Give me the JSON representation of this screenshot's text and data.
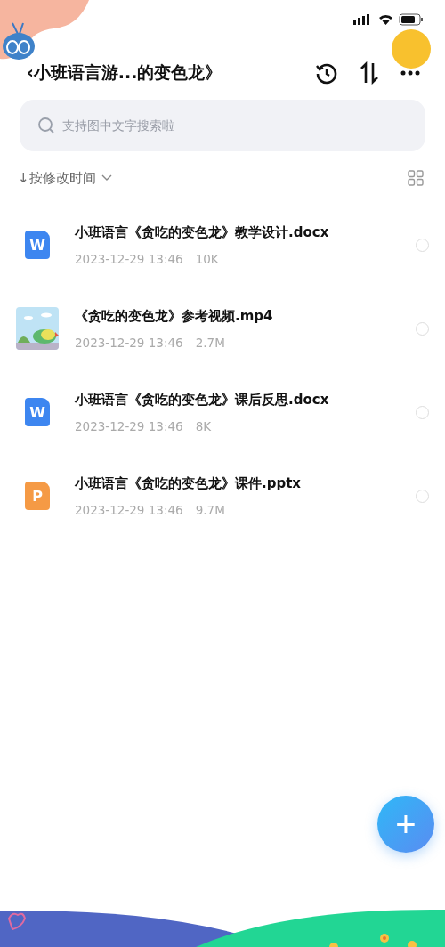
{
  "header": {
    "title": "‹小班语言游...的变色龙》"
  },
  "search": {
    "placeholder": "支持图中文字搜索啦"
  },
  "sort": {
    "label": "↓按修改时间"
  },
  "files": [
    {
      "kind": "word",
      "icon_letter": "W",
      "name": "小班语言《贪吃的变色龙》教学设计.docx",
      "date": "2023-12-29 13:46",
      "size": "10K",
      "selected": false
    },
    {
      "kind": "video",
      "name": "《贪吃的变色龙》参考视频.mp4",
      "date": "2023-12-29 13:46",
      "size": "2.7M",
      "selected": false
    },
    {
      "kind": "word",
      "icon_letter": "W",
      "name": "小班语言《贪吃的变色龙》课后反思.docx",
      "date": "2023-12-29 13:46",
      "size": "8K",
      "selected": false
    },
    {
      "kind": "ppt",
      "icon_letter": "P",
      "name": "小班语言《贪吃的变色龙》课件.pptx",
      "date": "2023-12-29 13:46",
      "size": "9.7M",
      "selected": false
    }
  ],
  "fab": {
    "label": "+"
  }
}
